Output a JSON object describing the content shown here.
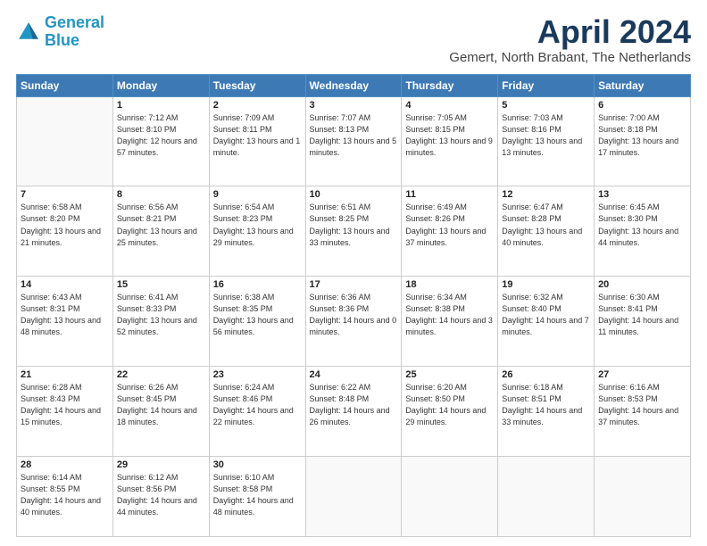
{
  "logo": {
    "line1": "General",
    "line2": "Blue"
  },
  "title": "April 2024",
  "subtitle": "Gemert, North Brabant, The Netherlands",
  "days_header": [
    "Sunday",
    "Monday",
    "Tuesday",
    "Wednesday",
    "Thursday",
    "Friday",
    "Saturday"
  ],
  "weeks": [
    [
      {
        "num": "",
        "sunrise": "",
        "sunset": "",
        "daylight": ""
      },
      {
        "num": "1",
        "sunrise": "Sunrise: 7:12 AM",
        "sunset": "Sunset: 8:10 PM",
        "daylight": "Daylight: 12 hours and 57 minutes."
      },
      {
        "num": "2",
        "sunrise": "Sunrise: 7:09 AM",
        "sunset": "Sunset: 8:11 PM",
        "daylight": "Daylight: 13 hours and 1 minute."
      },
      {
        "num": "3",
        "sunrise": "Sunrise: 7:07 AM",
        "sunset": "Sunset: 8:13 PM",
        "daylight": "Daylight: 13 hours and 5 minutes."
      },
      {
        "num": "4",
        "sunrise": "Sunrise: 7:05 AM",
        "sunset": "Sunset: 8:15 PM",
        "daylight": "Daylight: 13 hours and 9 minutes."
      },
      {
        "num": "5",
        "sunrise": "Sunrise: 7:03 AM",
        "sunset": "Sunset: 8:16 PM",
        "daylight": "Daylight: 13 hours and 13 minutes."
      },
      {
        "num": "6",
        "sunrise": "Sunrise: 7:00 AM",
        "sunset": "Sunset: 8:18 PM",
        "daylight": "Daylight: 13 hours and 17 minutes."
      }
    ],
    [
      {
        "num": "7",
        "sunrise": "Sunrise: 6:58 AM",
        "sunset": "Sunset: 8:20 PM",
        "daylight": "Daylight: 13 hours and 21 minutes."
      },
      {
        "num": "8",
        "sunrise": "Sunrise: 6:56 AM",
        "sunset": "Sunset: 8:21 PM",
        "daylight": "Daylight: 13 hours and 25 minutes."
      },
      {
        "num": "9",
        "sunrise": "Sunrise: 6:54 AM",
        "sunset": "Sunset: 8:23 PM",
        "daylight": "Daylight: 13 hours and 29 minutes."
      },
      {
        "num": "10",
        "sunrise": "Sunrise: 6:51 AM",
        "sunset": "Sunset: 8:25 PM",
        "daylight": "Daylight: 13 hours and 33 minutes."
      },
      {
        "num": "11",
        "sunrise": "Sunrise: 6:49 AM",
        "sunset": "Sunset: 8:26 PM",
        "daylight": "Daylight: 13 hours and 37 minutes."
      },
      {
        "num": "12",
        "sunrise": "Sunrise: 6:47 AM",
        "sunset": "Sunset: 8:28 PM",
        "daylight": "Daylight: 13 hours and 40 minutes."
      },
      {
        "num": "13",
        "sunrise": "Sunrise: 6:45 AM",
        "sunset": "Sunset: 8:30 PM",
        "daylight": "Daylight: 13 hours and 44 minutes."
      }
    ],
    [
      {
        "num": "14",
        "sunrise": "Sunrise: 6:43 AM",
        "sunset": "Sunset: 8:31 PM",
        "daylight": "Daylight: 13 hours and 48 minutes."
      },
      {
        "num": "15",
        "sunrise": "Sunrise: 6:41 AM",
        "sunset": "Sunset: 8:33 PM",
        "daylight": "Daylight: 13 hours and 52 minutes."
      },
      {
        "num": "16",
        "sunrise": "Sunrise: 6:38 AM",
        "sunset": "Sunset: 8:35 PM",
        "daylight": "Daylight: 13 hours and 56 minutes."
      },
      {
        "num": "17",
        "sunrise": "Sunrise: 6:36 AM",
        "sunset": "Sunset: 8:36 PM",
        "daylight": "Daylight: 14 hours and 0 minutes."
      },
      {
        "num": "18",
        "sunrise": "Sunrise: 6:34 AM",
        "sunset": "Sunset: 8:38 PM",
        "daylight": "Daylight: 14 hours and 3 minutes."
      },
      {
        "num": "19",
        "sunrise": "Sunrise: 6:32 AM",
        "sunset": "Sunset: 8:40 PM",
        "daylight": "Daylight: 14 hours and 7 minutes."
      },
      {
        "num": "20",
        "sunrise": "Sunrise: 6:30 AM",
        "sunset": "Sunset: 8:41 PM",
        "daylight": "Daylight: 14 hours and 11 minutes."
      }
    ],
    [
      {
        "num": "21",
        "sunrise": "Sunrise: 6:28 AM",
        "sunset": "Sunset: 8:43 PM",
        "daylight": "Daylight: 14 hours and 15 minutes."
      },
      {
        "num": "22",
        "sunrise": "Sunrise: 6:26 AM",
        "sunset": "Sunset: 8:45 PM",
        "daylight": "Daylight: 14 hours and 18 minutes."
      },
      {
        "num": "23",
        "sunrise": "Sunrise: 6:24 AM",
        "sunset": "Sunset: 8:46 PM",
        "daylight": "Daylight: 14 hours and 22 minutes."
      },
      {
        "num": "24",
        "sunrise": "Sunrise: 6:22 AM",
        "sunset": "Sunset: 8:48 PM",
        "daylight": "Daylight: 14 hours and 26 minutes."
      },
      {
        "num": "25",
        "sunrise": "Sunrise: 6:20 AM",
        "sunset": "Sunset: 8:50 PM",
        "daylight": "Daylight: 14 hours and 29 minutes."
      },
      {
        "num": "26",
        "sunrise": "Sunrise: 6:18 AM",
        "sunset": "Sunset: 8:51 PM",
        "daylight": "Daylight: 14 hours and 33 minutes."
      },
      {
        "num": "27",
        "sunrise": "Sunrise: 6:16 AM",
        "sunset": "Sunset: 8:53 PM",
        "daylight": "Daylight: 14 hours and 37 minutes."
      }
    ],
    [
      {
        "num": "28",
        "sunrise": "Sunrise: 6:14 AM",
        "sunset": "Sunset: 8:55 PM",
        "daylight": "Daylight: 14 hours and 40 minutes."
      },
      {
        "num": "29",
        "sunrise": "Sunrise: 6:12 AM",
        "sunset": "Sunset: 8:56 PM",
        "daylight": "Daylight: 14 hours and 44 minutes."
      },
      {
        "num": "30",
        "sunrise": "Sunrise: 6:10 AM",
        "sunset": "Sunset: 8:58 PM",
        "daylight": "Daylight: 14 hours and 48 minutes."
      },
      {
        "num": "",
        "sunrise": "",
        "sunset": "",
        "daylight": ""
      },
      {
        "num": "",
        "sunrise": "",
        "sunset": "",
        "daylight": ""
      },
      {
        "num": "",
        "sunrise": "",
        "sunset": "",
        "daylight": ""
      },
      {
        "num": "",
        "sunrise": "",
        "sunset": "",
        "daylight": ""
      }
    ]
  ]
}
